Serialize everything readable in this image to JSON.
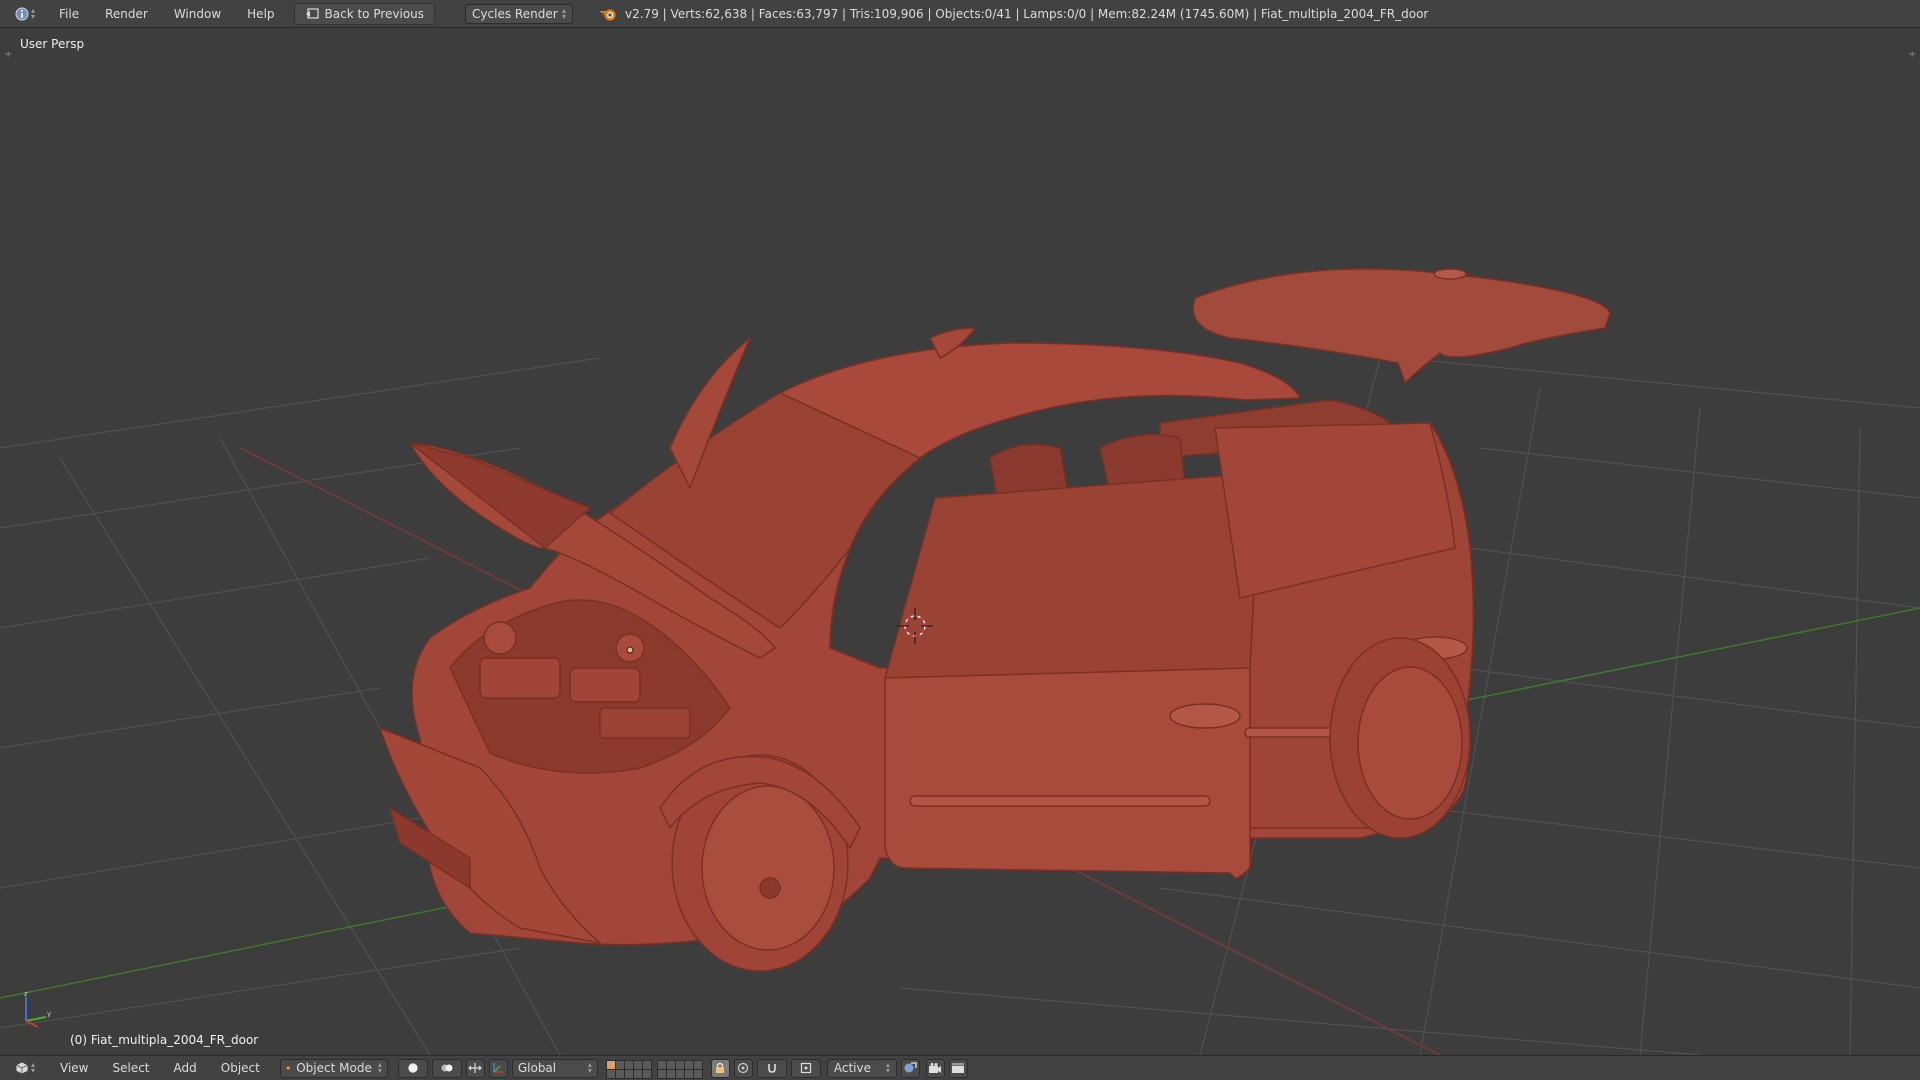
{
  "header": {
    "menus": [
      "File",
      "Render",
      "Window",
      "Help"
    ],
    "back_button": "Back to Previous",
    "render_engine": "Cycles Render",
    "stats": "v2.79 | Verts:62,638 | Faces:63,797 | Tris:109,906 | Objects:0/41 | Lamps:0/0 | Mem:82.24M (1745.60M) | Fiat_multipla_2004_FR_door"
  },
  "viewport": {
    "view_name": "User Persp",
    "active_object_label": "(0) Fiat_multipla_2004_FR_door",
    "background_color": "#3d3d3d",
    "grid_color": "#535353",
    "x_axis_color": "#8a3a3a",
    "y_axis_color": "#3f7a2c",
    "model_color": "#a54a3c"
  },
  "footer": {
    "menus": [
      "View",
      "Select",
      "Add",
      "Object"
    ],
    "mode": "Object Mode",
    "orientation": "Global",
    "pivot_mode": "Active",
    "icons": [
      "editor-type-icon",
      "viewport-shading-icon",
      "pivot-point-icon",
      "manipulator-icon",
      "transform-orientation-icon",
      "layers-icon",
      "lock-icon",
      "proportional-edit-icon",
      "snap-icon",
      "render-icon",
      "camera-icon"
    ]
  }
}
